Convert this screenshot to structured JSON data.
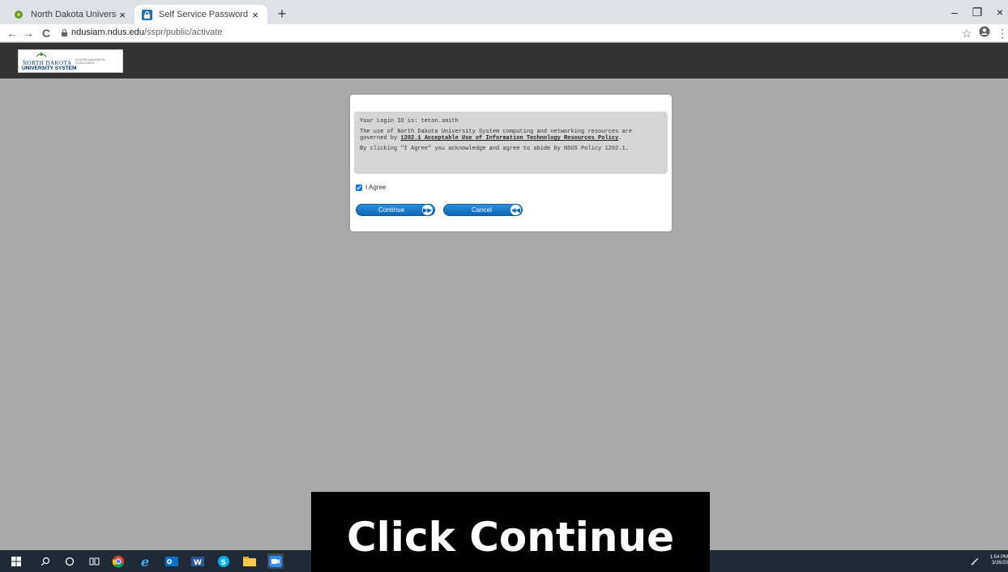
{
  "browser": {
    "tabs": [
      {
        "title": "North Dakota University System",
        "close": "×"
      },
      {
        "title": "Self Service Password Reset",
        "close": "×"
      }
    ],
    "new_tab": "+",
    "window_controls": {
      "minimize": "–",
      "restore": "❐",
      "close": "×"
    },
    "nav": {
      "back": "←",
      "forward": "→",
      "reload": "C"
    },
    "url_host": "ndusiam.ndus.edu",
    "url_path": "/sspr/public/activate",
    "toolbar_right": {
      "star": "☆",
      "account": "👤",
      "menu": "⋮"
    }
  },
  "site": {
    "logo_line1": "NORTH DAKOTA",
    "logo_line2": "UNIVERSITY SYSTEM",
    "logo_tagline": "ACCESS INNOVATION EXCELLENCE"
  },
  "dialog": {
    "login_line": "Your Login ID is: teton.smith",
    "policy_prefix": "The use of North Dakota University System computing and networking resources are governed by ",
    "policy_link": "1202.1 Acceptable Use of Information Technology Resources Policy",
    "policy_suffix": ".",
    "agree_text": "By clicking \"I Agree\" you acknowledge and agree to abide by NDUS Policy 1202.1.",
    "checkbox_label": "I Agree",
    "continue_label": "Continue",
    "cancel_label": "Cancel",
    "continue_glyph": "▶▶",
    "cancel_glyph": "◀◀"
  },
  "caption": "Click Continue",
  "taskbar": {
    "time": "1:54 PM",
    "date": "3/26/20"
  },
  "colors": {
    "page_bg": "#a9a9a9",
    "header_bg": "#333333",
    "button_blue": "#0c66b5",
    "taskbar_bg": "#1f2a36"
  }
}
